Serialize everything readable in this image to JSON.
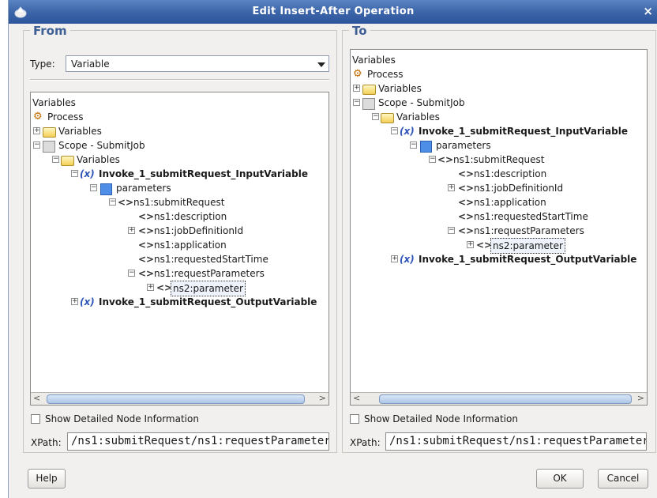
{
  "window": {
    "title": "Edit Insert-After Operation",
    "close": "×"
  },
  "from": {
    "title": "From",
    "type_label": "Type:",
    "type_value": "Variable",
    "tree": {
      "root": "Variables",
      "process": "Process",
      "variables": "Variables",
      "scope": "Scope - SubmitJob",
      "scope_variables": "Variables",
      "var_symbol": "(x)",
      "input_var": "Invoke_1_submitRequest_InputVariable",
      "parameters": "parameters",
      "submit_request": "ns1:submitRequest",
      "description": "ns1:description",
      "job_def": "ns1:jobDefinitionId",
      "application": "ns1:application",
      "start_time": "ns1:requestedStartTime",
      "req_params": "ns1:requestParameters",
      "parameter": "ns2:parameter",
      "output_var": "Invoke_1_submitRequest_OutputVariable"
    },
    "show_detail": "Show Detailed Node Information",
    "xpath_label": "XPath:",
    "xpath_value": "/ns1:submitRequest/ns1:requestParameter"
  },
  "to": {
    "title": "To",
    "tree": {
      "root": "Variables",
      "process": "Process",
      "variables": "Variables",
      "scope": "Scope - SubmitJob",
      "scope_variables": "Variables",
      "var_symbol": "(x)",
      "input_var": "Invoke_1_submitRequest_InputVariable",
      "parameters": "parameters",
      "submit_request": "ns1:submitRequest",
      "description": "ns1:description",
      "job_def": "ns1:jobDefinitionId",
      "application": "ns1:application",
      "start_time": "ns1:requestedStartTime",
      "req_params": "ns1:requestParameters",
      "parameter": "ns2:parameter",
      "output_var": "Invoke_1_submitRequest_OutputVariable"
    },
    "show_detail": "Show Detailed Node Information",
    "xpath_label": "XPath:",
    "xpath_value": "/ns1:submitRequest/ns1:requestParameter"
  },
  "buttons": {
    "help": "Help",
    "ok": "OK",
    "cancel": "Cancel"
  },
  "icons": {
    "app": "app-icon",
    "folder": "folder-icon",
    "process": "process-icon",
    "scope": "scope-icon",
    "variable": "variable-icon",
    "parameters": "parameters-icon",
    "element": "element-icon",
    "expand": "expand-toggle-icon",
    "collapse": "collapse-toggle-icon"
  },
  "colors": {
    "title_bar": "#3a63a8",
    "panel_title": "#3f5f95",
    "variable_icon": "#2e55b8",
    "background": "#f1f0ee"
  }
}
